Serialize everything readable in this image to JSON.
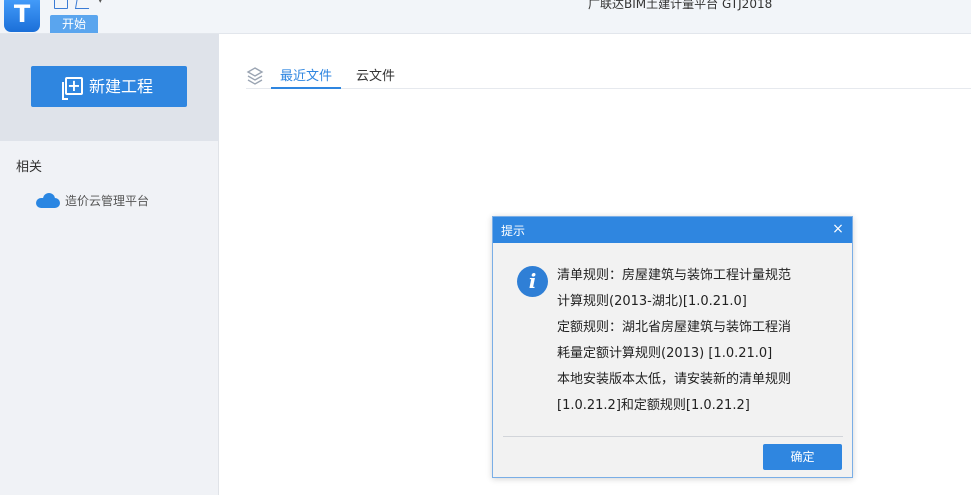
{
  "app": {
    "title": "广联达BIM土建计量平台 GTJ2018",
    "logo_letter": "T",
    "ribbon_tab_start": "开始"
  },
  "sidebar": {
    "new_project_label": "新建工程",
    "related_title": "相关",
    "links": [
      {
        "label": "造价云管理平台",
        "icon": "cloud-icon"
      }
    ]
  },
  "main": {
    "tabs": [
      {
        "label": "最近文件",
        "active": true
      },
      {
        "label": "云文件",
        "active": false
      }
    ]
  },
  "dialog": {
    "title": "提示",
    "close_glyph": "×",
    "icon": "info-icon",
    "icon_glyph": "i",
    "lines": [
      "清单规则：房屋建筑与装饰工程计量规范",
      "计算规则(2013-湖北)[1.0.21.0]",
      "定额规则：湖北省房屋建筑与装饰工程消",
      "耗量定额计算规则(2013) [1.0.21.0]",
      "本地安装版本太低，请安装新的清单规则",
      "[1.0.21.2]和定额规则[1.0.21.2]"
    ],
    "ok_label": "确定"
  },
  "colors": {
    "accent": "#2f86e0",
    "sidebar_bg": "#f0f2f6",
    "sidebar_top_bg": "#dfe3ea"
  }
}
